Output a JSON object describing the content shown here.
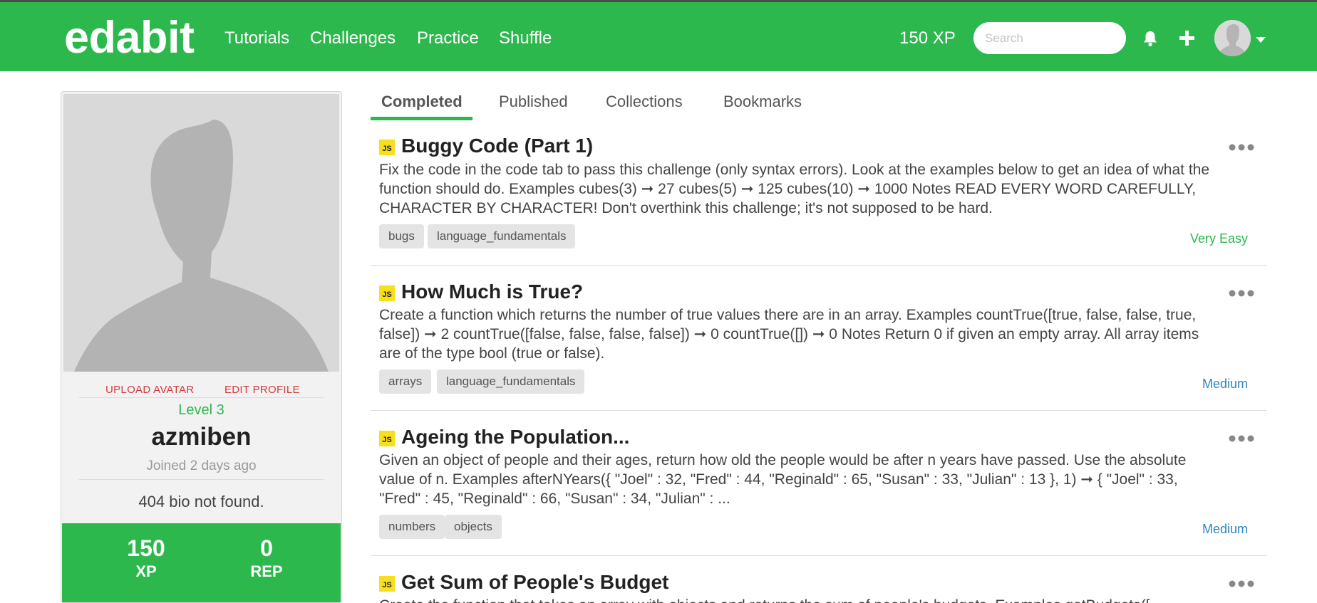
{
  "navbar": {
    "brand": "edabit",
    "links": [
      "Tutorials",
      "Challenges",
      "Practice",
      "Shuffle"
    ],
    "xp": "150 XP",
    "search_placeholder": "Search",
    "bg_color": "#2db84d"
  },
  "profile": {
    "upload_avatar": "UPLOAD AVATAR",
    "edit_profile": "EDIT PROFILE",
    "level": "Level 3",
    "username": "azmiben",
    "joined": "Joined 2 days ago",
    "bio": "404 bio not found.",
    "stats": [
      {
        "value": "150",
        "label": "XP"
      },
      {
        "value": "0",
        "label": "REP"
      }
    ]
  },
  "tabs": [
    "Completed",
    "Published",
    "Collections",
    "Bookmarks"
  ],
  "active_tab": "Completed",
  "challenges": [
    {
      "lang": "JS",
      "title": "Buggy Code (Part 1)",
      "description": "Fix the code in the code tab to pass this challenge (only syntax errors). Look at the examples below to get an idea of what the function should do. Examples cubes(3) ➞ 27 cubes(5) ➞ 125 cubes(10) ➞ 1000 Notes READ EVERY WORD CAREFULLY, CHARACTER BY CHARACTER! Don't overthink this challenge; it's not supposed to be hard.",
      "tags": [
        "bugs",
        "language_fundamentals"
      ],
      "difficulty": "Very Easy",
      "difficulty_color": "#2db84d"
    },
    {
      "lang": "JS",
      "title": "How Much is True?",
      "description": "Create a function which returns the number of true values there are in an array. Examples countTrue([true, false, false, true, false]) ➞ 2 countTrue([false, false, false, false]) ➞ 0 countTrue([]) ➞ 0 Notes Return 0 if given an empty array. All array items are of the type bool (true or false).",
      "tags": [
        "arrays",
        "language_fundamentals"
      ],
      "difficulty": "Medium",
      "difficulty_color": "#2e86c1"
    },
    {
      "lang": "JS",
      "title": "Ageing the Population...",
      "description": "Given an object of people and their ages, return how old the people would be after n years have passed. Use the absolute value of n. Examples afterNYears({ \"Joel\" : 32, \"Fred\" : 44, \"Reginald\" : 65, \"Susan\" : 33, \"Julian\" : 13 }, 1) ➞ { \"Joel\" : 33, \"Fred\" : 45, \"Reginald\" : 66, \"Susan\" : 34, \"Julian\" : ...",
      "tags": [
        "numbers",
        "objects"
      ],
      "difficulty": "Medium",
      "difficulty_color": "#2e86c1"
    },
    {
      "lang": "JS",
      "title": "Get Sum of People's Budget",
      "description": "Create the function that takes an array with objects and returns the sum of people's budgets. Examples getBudgets([",
      "tags": [],
      "difficulty": "",
      "difficulty_color": "#2e86c1"
    }
  ]
}
